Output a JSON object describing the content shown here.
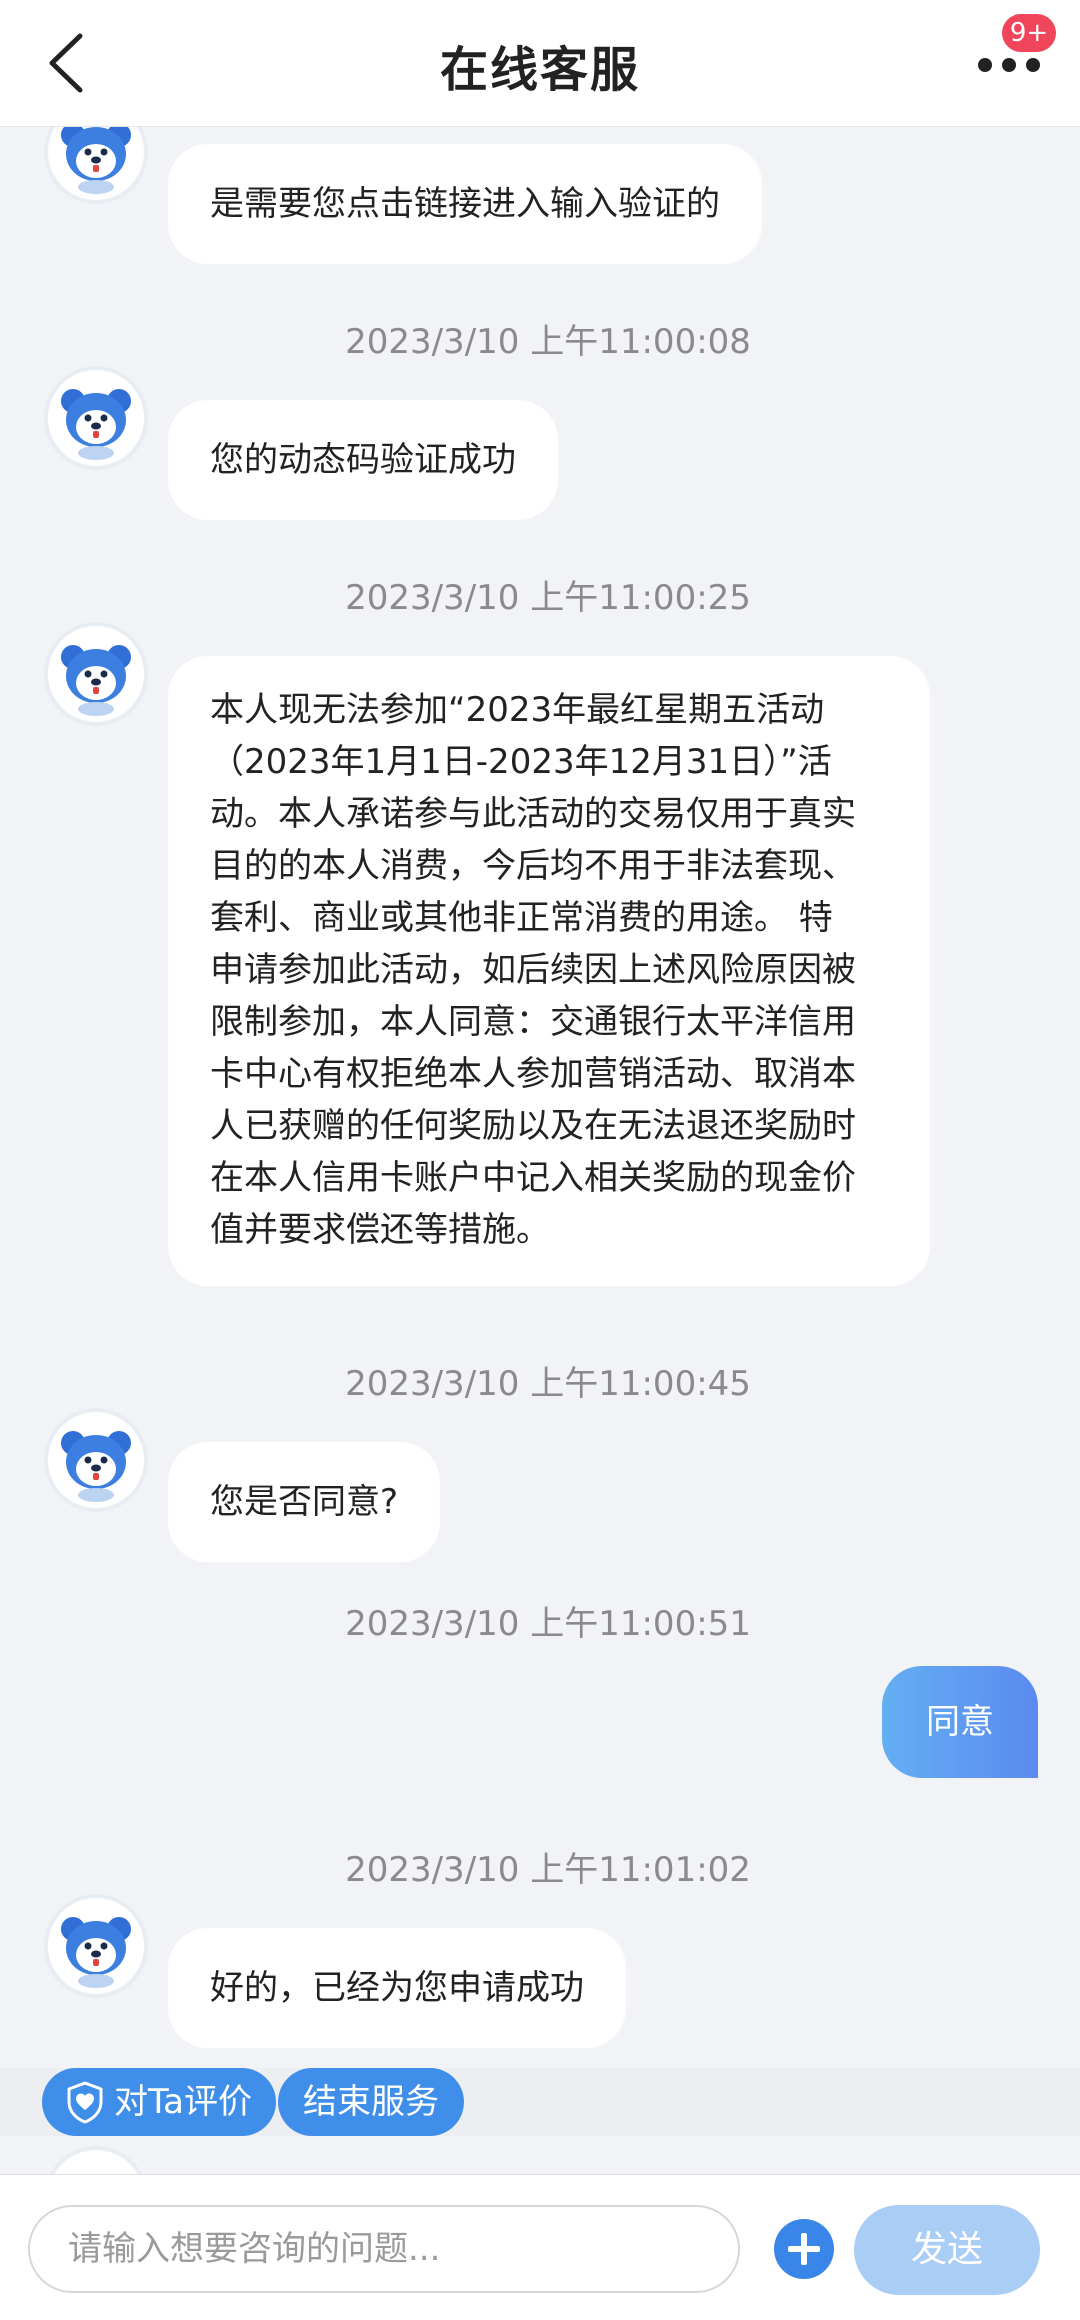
{
  "header": {
    "title": "在线客服",
    "badge": "9+",
    "back_icon": "chevron-left-icon",
    "more_icon": "more-dots-icon"
  },
  "messages": [
    {
      "from": "agent",
      "text": "是需要您点击链接进入输入验证的"
    },
    {
      "timestamp": "2023/3/10 上午11:00:08",
      "from": "agent",
      "text": "您的动态码验证成功"
    },
    {
      "timestamp": "2023/3/10 上午11:00:25",
      "from": "agent",
      "lines": [
        "本人现无法参加“2023年最红星期五活动",
        "（2023年1月1日-2023年12月31日）”活",
        "动。本人承诺参与此活动的交易仅用于真实",
        "目的的本人消费，今后均不用于非法套现、",
        "套利、商业或其他非正常消费的用途。 特",
        "申请参加此活动，如后续因上述风险原因被",
        "限制参加，本人同意：交通银行太平洋信用",
        "卡中心有权拒绝本人参加营销活动、取消本",
        "人已获赠的任何奖励以及在无法退还奖励时",
        "在本人信用卡账户中记入相关奖励的现金价",
        "值并要求偿还等措施。"
      ]
    },
    {
      "timestamp": "2023/3/10 上午11:00:45",
      "from": "agent",
      "text": "您是否同意?"
    },
    {
      "timestamp": "2023/3/10 上午11:00:51",
      "from": "user",
      "text": "同意"
    },
    {
      "timestamp": "2023/3/10 上午11:01:02",
      "from": "agent",
      "text": "好的，已经为您申请成功"
    }
  ],
  "quick_actions": {
    "rate_label": "对Ta评价",
    "rate_icon": "shield-heart-icon",
    "end_label": "结束服务"
  },
  "input": {
    "placeholder": "请输入想要咨询的问题...",
    "plus_icon": "plus-circle-icon",
    "send_label": "发送"
  },
  "colors": {
    "accent": "#3f8fea",
    "user_bubble_start": "#63aff2",
    "user_bubble_end": "#5b8af0",
    "send_disabled": "#a9cdf5",
    "badge": "#f0455a",
    "background": "#f2f3f7"
  }
}
